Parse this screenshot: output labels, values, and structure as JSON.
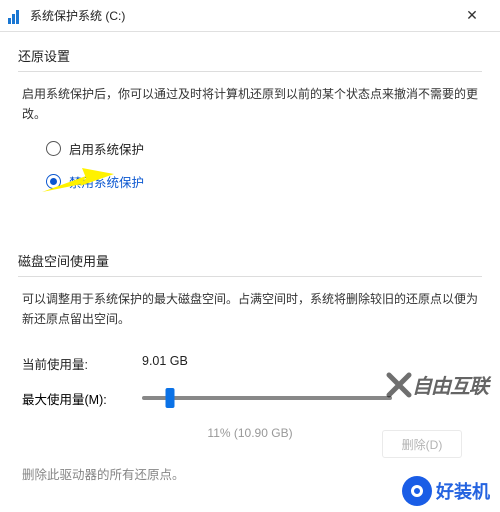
{
  "titlebar": {
    "title": "系统保护系统 (C:)",
    "close_symbol": "✕"
  },
  "restore": {
    "heading": "还原设置",
    "description": "启用系统保护后，你可以通过及时将计算机还原到以前的某个状态点来撤消不需要的更改。",
    "options": {
      "enable": "启用系统保护",
      "disable": "禁用系统保护"
    }
  },
  "disk": {
    "heading": "磁盘空间使用量",
    "description": "可以调整用于系统保护的最大磁盘空间。占满空间时，系统将删除较旧的还原点以便为新还原点留出空间。",
    "current_label": "当前使用量:",
    "current_value": "9.01 GB",
    "max_label": "最大使用量(M):",
    "slider_value": "11% (10.90 GB)"
  },
  "delete": {
    "text": "删除此驱动器的所有还原点。",
    "button": "删除(D)"
  },
  "watermarks": {
    "w1": "自由互联",
    "w2": "好装机"
  }
}
